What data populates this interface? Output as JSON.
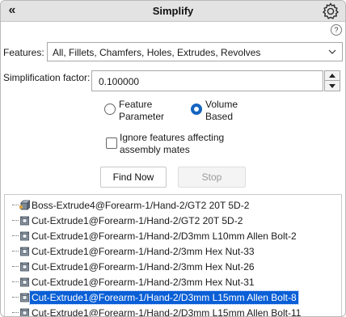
{
  "title": "Simplify",
  "icons": {
    "collapse": "double-chevron-left-icon",
    "settings": "gear-icon",
    "help": "help-icon",
    "dropdown": "chevron-down-icon",
    "spinner_up": "arrow-up-icon",
    "spinner_down": "arrow-down-icon",
    "feature_boss": "boss-extrude-icon",
    "feature_cut": "cut-extrude-icon"
  },
  "collapse_glyph": "«",
  "help_glyph": "?",
  "features": {
    "label": "Features:",
    "value": "All, Fillets, Chamfers, Holes, Extrudes, Revolves"
  },
  "simplification": {
    "label": "Simplification factor:",
    "value": "0.100000"
  },
  "options": {
    "feature_parameter": {
      "label_line1": "Feature",
      "label_line2": "Parameter",
      "selected": false
    },
    "volume_based": {
      "label_line1": "Volume",
      "label_line2": "Based",
      "selected": true
    },
    "ignore_mates": {
      "label_line1": "Ignore features affecting",
      "label_line2": "assembly mates",
      "checked": false
    }
  },
  "buttons": {
    "find": "Find Now",
    "stop": "Stop"
  },
  "results": [
    {
      "text": "Boss-Extrude4@Forearm-1/Hand-2/GT2 20T 5D-2",
      "icon": "boss",
      "selected": false
    },
    {
      "text": "Cut-Extrude1@Forearm-1/Hand-2/GT2 20T 5D-2",
      "icon": "cut",
      "selected": false
    },
    {
      "text": "Cut-Extrude1@Forearm-1/Hand-2/D3mm L10mm Allen Bolt-2",
      "icon": "cut",
      "selected": false
    },
    {
      "text": "Cut-Extrude1@Forearm-1/Hand-2/3mm Hex Nut-33",
      "icon": "cut",
      "selected": false
    },
    {
      "text": "Cut-Extrude1@Forearm-1/Hand-2/3mm Hex Nut-26",
      "icon": "cut",
      "selected": false
    },
    {
      "text": "Cut-Extrude1@Forearm-1/Hand-2/3mm Hex Nut-31",
      "icon": "cut",
      "selected": false
    },
    {
      "text": "Cut-Extrude1@Forearm-1/Hand-2/D3mm L15mm Allen Bolt-8",
      "icon": "cut",
      "selected": true
    },
    {
      "text": "Cut-Extrude1@Forearm-1/Hand-2/D3mm L15mm Allen Bolt-11",
      "icon": "cut",
      "selected": false
    }
  ],
  "colors": {
    "titlebar": "#e3e3e3",
    "selection": "#0a5fd6",
    "radio_selected": "#1565c0"
  }
}
